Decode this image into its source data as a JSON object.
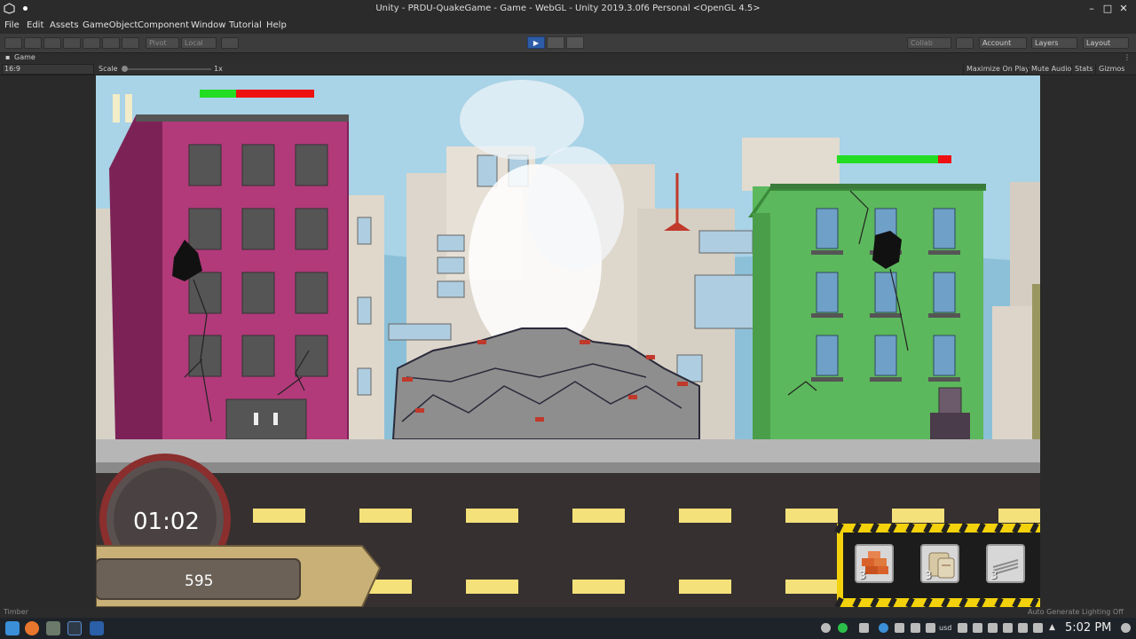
{
  "window": {
    "title": "Unity - PRDU-QuakeGame - Game - WebGL - Unity 2019.3.0f6 Personal <OpenGL 4.5>"
  },
  "menu": [
    "File",
    "Edit",
    "Assets",
    "GameObject",
    "Component",
    "Window",
    "Tutorial",
    "Help"
  ],
  "toolbar": {
    "pivot": "Pivot",
    "local": "Local",
    "collab": "Collab",
    "account": "Account",
    "layers": "Layers",
    "layout": "Layout",
    "play_icon": "play-icon"
  },
  "game_view": {
    "tab": "Game",
    "aspect": "16:9",
    "scale_label": "Scale",
    "scale_value": "1x",
    "maximize": "Maximize On Play",
    "mute": "Mute Audio",
    "stats": "Stats",
    "gizmos": "Gizmos"
  },
  "game": {
    "timer": "01:02",
    "score": "595",
    "left_building_health": 0.32,
    "right_building_health": 0.88,
    "items": [
      {
        "name": "bricks",
        "count": "3"
      },
      {
        "name": "cement-bags",
        "count": "3"
      },
      {
        "name": "steel-rods",
        "count": "3"
      }
    ]
  },
  "status": {
    "left": "Timber",
    "right": "Auto Generate Lighting Off"
  },
  "taskbar": {
    "clock": "5:02 PM",
    "tray_label": "usd"
  },
  "colors": {
    "health_green": "#22dd22",
    "health_red": "#ee1111",
    "building_left": "#b23a7a",
    "building_right": "#5cb85c"
  }
}
